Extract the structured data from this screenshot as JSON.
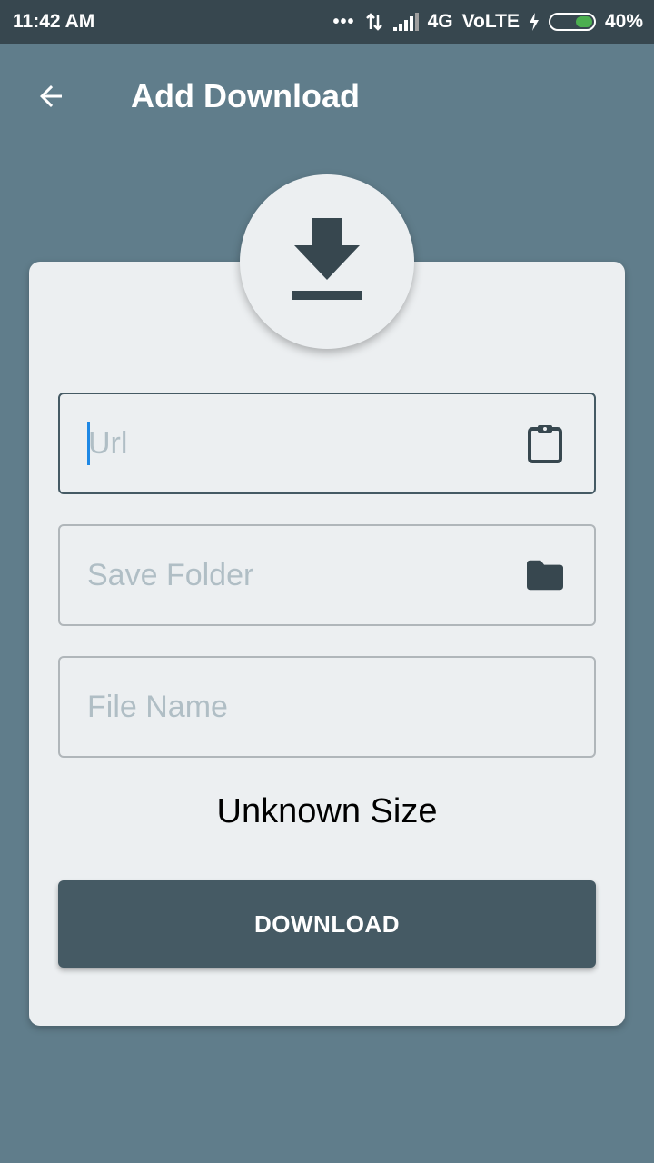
{
  "status_bar": {
    "time": "11:42 AM",
    "dots": "•••",
    "network": "4G",
    "volte": "VoLTE",
    "battery": "40%",
    "battery_level": 0.4,
    "battery_color": "#4caf50"
  },
  "app_bar": {
    "back_icon": "arrow-back-icon",
    "title": "Add Download"
  },
  "header_icon": "download-icon",
  "form": {
    "url": {
      "value": "",
      "placeholder": "Url",
      "icon": "clipboard-icon",
      "focused": true
    },
    "save_folder": {
      "value": "",
      "placeholder": "Save Folder",
      "icon": "folder-icon"
    },
    "file_name": {
      "value": "",
      "placeholder": "File Name"
    }
  },
  "size_label": "Unknown Size",
  "download_button": "DOWNLOAD",
  "colors": {
    "background": "#607d8b",
    "status_bar": "#37474f",
    "card": "#eceff1",
    "accent": "#455a64",
    "cursor": "#1e88e5"
  }
}
